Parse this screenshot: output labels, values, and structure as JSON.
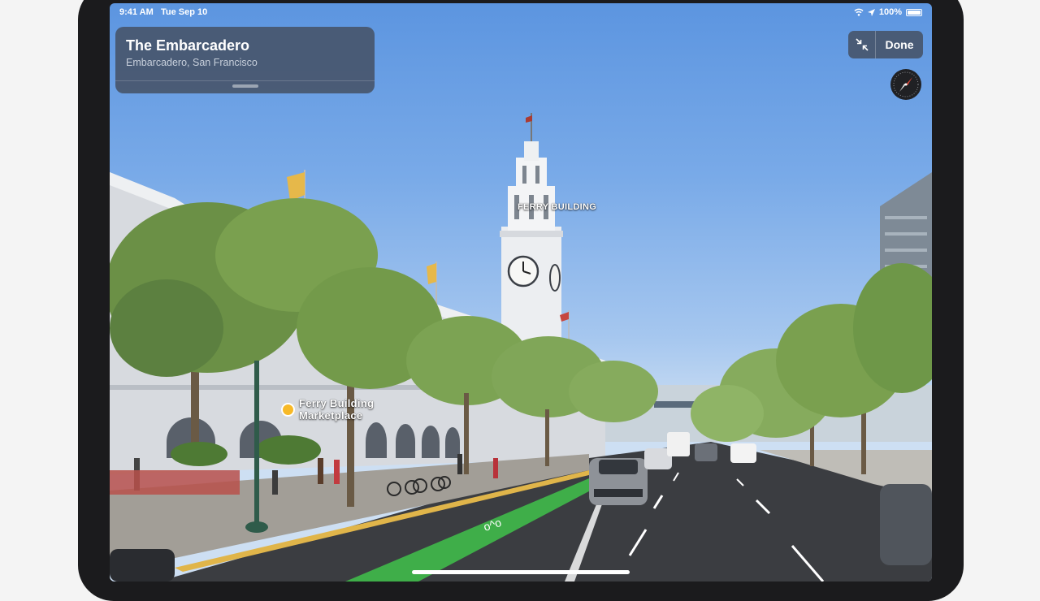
{
  "status_bar": {
    "time": "9:41 AM",
    "date": "Tue Sep 10",
    "battery": "100%"
  },
  "place_card": {
    "title": "The Embarcadero",
    "subtitle": "Embarcadero, San Francisco"
  },
  "controls": {
    "done_label": "Done",
    "collapse_icon": "collapse-arrows-icon"
  },
  "compass": {
    "icon": "compass-icon"
  },
  "poi_labels": {
    "ferry_building": "FERRY BUILDING",
    "marketplace_line1": "Ferry Building",
    "marketplace_line2": "Marketplace"
  },
  "colors": {
    "sky": "#79aae8",
    "card": "#465266",
    "bike_lane": "#3fae49",
    "poi_dot": "#f7b928"
  }
}
